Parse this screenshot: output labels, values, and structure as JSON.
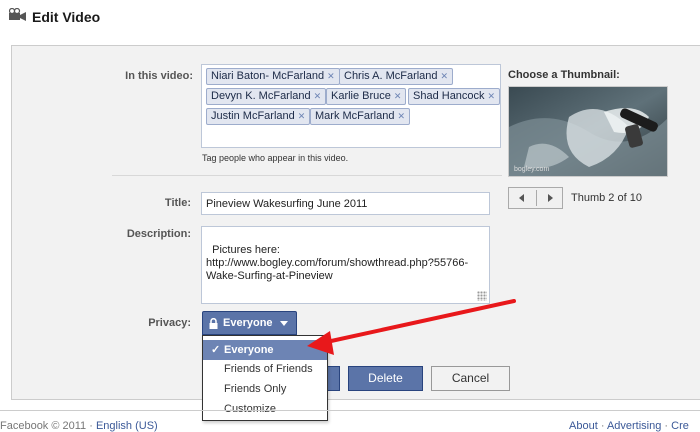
{
  "header": {
    "title": "Edit Video",
    "icon": "video-camera-icon"
  },
  "tags": {
    "label": "In this video:",
    "people": [
      "Niari Baton- McFarland",
      "Chris A. McFarland",
      "Devyn K. McFarland",
      "Karlie Bruce",
      "Shad Hancock",
      "Justin McFarland",
      "Mark McFarland"
    ],
    "remove_glyph": "✕",
    "hint": "Tag people who appear in this video."
  },
  "title_field": {
    "label": "Title:",
    "value": "Pineview Wakesurfing June 2011"
  },
  "description_field": {
    "label": "Description:",
    "value": "Pictures here:\nhttp://www.bogley.com/forum/showthread.php?55766-\nWake-Surfing-at-Pineview"
  },
  "privacy": {
    "label": "Privacy:",
    "selected": "Everyone",
    "icon": "lock-icon",
    "options": [
      "Everyone",
      "Friends of Friends",
      "Friends Only",
      "Customize"
    ],
    "check_glyph": "✓"
  },
  "actions": {
    "delete_label": "Delete",
    "cancel_label": "Cancel"
  },
  "thumbnail": {
    "label": "Choose a Thumbnail:",
    "counter": "Thumb 2 of 10",
    "watermark": "bogley.com",
    "prev_icon": "chevron-left-icon",
    "next_icon": "chevron-right-icon"
  },
  "footer": {
    "copyright": "Facebook © 2011 ·",
    "language": "English (US)",
    "about": "About",
    "separator": "·",
    "advertising": "Advertising",
    "more": "Cre"
  },
  "colors": {
    "fb_blue": "#3b5998",
    "button_blue": "#5b74a8",
    "annotation_red": "#e8181b"
  }
}
